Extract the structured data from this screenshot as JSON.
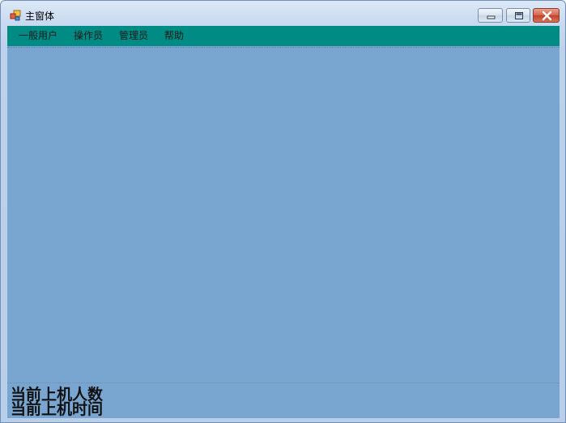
{
  "window": {
    "title": "主窗体",
    "icon": "app-window-icon",
    "controls": [
      "minimize-icon",
      "maximize-icon",
      "close-icon"
    ]
  },
  "menu": {
    "items": [
      {
        "label": "一般用户"
      },
      {
        "label": "操作员"
      },
      {
        "label": "管理员"
      },
      {
        "label": "帮助"
      }
    ],
    "background": "#008b84"
  },
  "status": {
    "online_count_label": "当前上机人数",
    "online_time_label": "当前上机时间"
  },
  "colors": {
    "client_background": "#78a6d1",
    "title_gradient_top": "#dce8f6"
  }
}
